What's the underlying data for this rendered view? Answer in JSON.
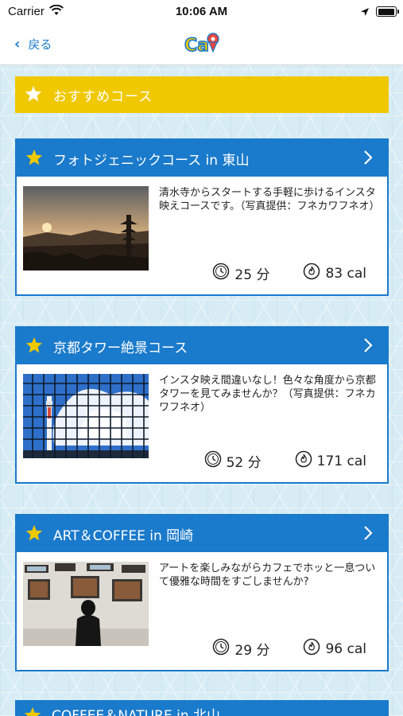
{
  "status_bar": {
    "carrier": "Carrier",
    "time": "10:06 AM"
  },
  "nav": {
    "back_label": "戻る",
    "logo_text": "Ca"
  },
  "banner": {
    "title": "おすすめコース"
  },
  "courses": [
    {
      "name": "フォトジェニックコース in 東山",
      "description": "清水寺からスタートする手軽に歩けるインスタ映えコースです。（写真提供：フネカワフネオ）",
      "time": "25 分",
      "cal": "83 cal"
    },
    {
      "name": "京都タワー絶景コース",
      "description": "インスタ映え間違いなし！色々な角度から京都タワーを見てみませんか？（写真提供：フネカワフネオ）",
      "time": "52 分",
      "cal": "171 cal"
    },
    {
      "name": "ART＆COFFEE in 岡崎",
      "description": "アートを楽しみながらカフェでホッと一息ついて優雅な時間をすごしませんか?",
      "time": "29 分",
      "cal": "96 cal"
    },
    {
      "name": "COFFEE＆NATURE in 北山"
    }
  ],
  "colors": {
    "accent": "#1a7acb",
    "banner": "#f0c800",
    "star": "#f0c800"
  },
  "icons": {
    "back": "chevron-left-icon",
    "star": "star-icon",
    "arrow": "chevron-right-icon",
    "time": "clock-icon",
    "cal": "flame-icon"
  }
}
